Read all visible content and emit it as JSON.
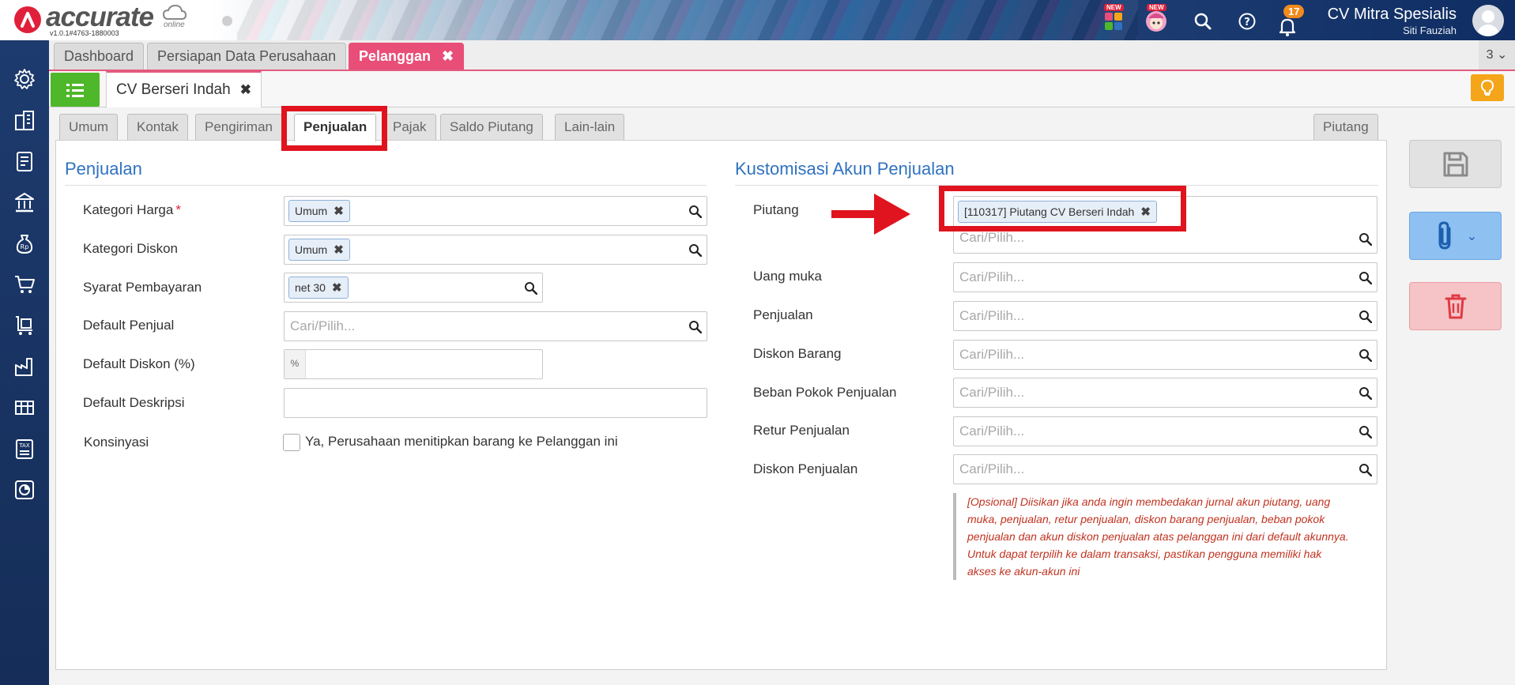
{
  "header": {
    "brand": "accurate",
    "brand_sub": "online",
    "version": "v1.0.1#4763-1880003",
    "new_badge_1": "NEW",
    "new_badge_2": "NEW",
    "notification_count": "17",
    "company_name": "CV Mitra Spesialis",
    "user_name": "Siti Fauziah"
  },
  "sidebar": {
    "items": [
      "gear-icon",
      "building-icon",
      "ledger-icon",
      "bank-icon",
      "money-bag-icon",
      "cart-icon",
      "delivery-cart-icon",
      "factory-icon",
      "warehouse-icon",
      "tax-icon",
      "report-icon"
    ]
  },
  "module_tabs": {
    "tabs": [
      "Dashboard",
      "Persiapan Data Perusahaan",
      "Pelanggan"
    ],
    "active": "Pelanggan",
    "counter": "3"
  },
  "record": {
    "title": "CV Berseri Indah"
  },
  "form_tabs": {
    "tabs": [
      "Umum",
      "Kontak",
      "Pengiriman",
      "Penjualan",
      "Pajak",
      "Saldo Piutang",
      "Lain-lain"
    ],
    "right_tab": "Piutang",
    "active": "Penjualan"
  },
  "left_section": {
    "title": "Penjualan",
    "fields": {
      "kategori_harga": {
        "label": "Kategori Harga",
        "required": "*",
        "value": "Umum"
      },
      "kategori_diskon": {
        "label": "Kategori Diskon",
        "value": "Umum"
      },
      "syarat_pembayaran": {
        "label": "Syarat Pembayaran",
        "value": "net 30"
      },
      "default_penjual": {
        "label": "Default Penjual",
        "placeholder": "Cari/Pilih..."
      },
      "default_diskon": {
        "label": "Default Diskon (%)",
        "addon": "%",
        "value": ""
      },
      "default_deskripsi": {
        "label": "Default Deskripsi",
        "value": ""
      },
      "konsinyasi": {
        "label": "Konsinyasi",
        "checkbox_label": "Ya, Perusahaan menitipkan barang ke Pelanggan ini",
        "checked": false
      }
    }
  },
  "right_section": {
    "title": "Kustomisasi Akun Penjualan",
    "fields": {
      "piutang": {
        "label": "Piutang",
        "value": "[110317] Piutang CV Berseri Indah",
        "placeholder": "Cari/Pilih..."
      },
      "uang_muka": {
        "label": "Uang muka",
        "placeholder": "Cari/Pilih..."
      },
      "penjualan": {
        "label": "Penjualan",
        "placeholder": "Cari/Pilih..."
      },
      "diskon_barang": {
        "label": "Diskon Barang",
        "placeholder": "Cari/Pilih..."
      },
      "beban_pokok": {
        "label": "Beban Pokok Penjualan",
        "placeholder": "Cari/Pilih..."
      },
      "retur_penjualan": {
        "label": "Retur Penjualan",
        "placeholder": "Cari/Pilih..."
      },
      "diskon_penjualan": {
        "label": "Diskon Penjualan",
        "placeholder": "Cari/Pilih..."
      }
    },
    "note_lines": [
      "[Opsional] Diisikan jika anda ingin membedakan jurnal akun piutang, uang",
      "muka, penjualan, retur penjualan, diskon barang penjualan, beban pokok",
      "penjualan dan akun diskon penjualan atas pelanggan ini dari default akunnya.",
      "Untuk dapat terpilih ke dalam transaksi, pastikan pengguna memiliki hak",
      "akses ke akun-akun ini"
    ]
  },
  "actions": {
    "save": "save-icon",
    "attach": "paperclip-icon",
    "delete": "trash-icon"
  },
  "colors": {
    "accent_pink": "#e84e78",
    "link_blue": "#2f72c0",
    "highlight_red": "#e0141e",
    "list_green": "#4fb72a",
    "bulb_orange": "#f5a51a"
  }
}
